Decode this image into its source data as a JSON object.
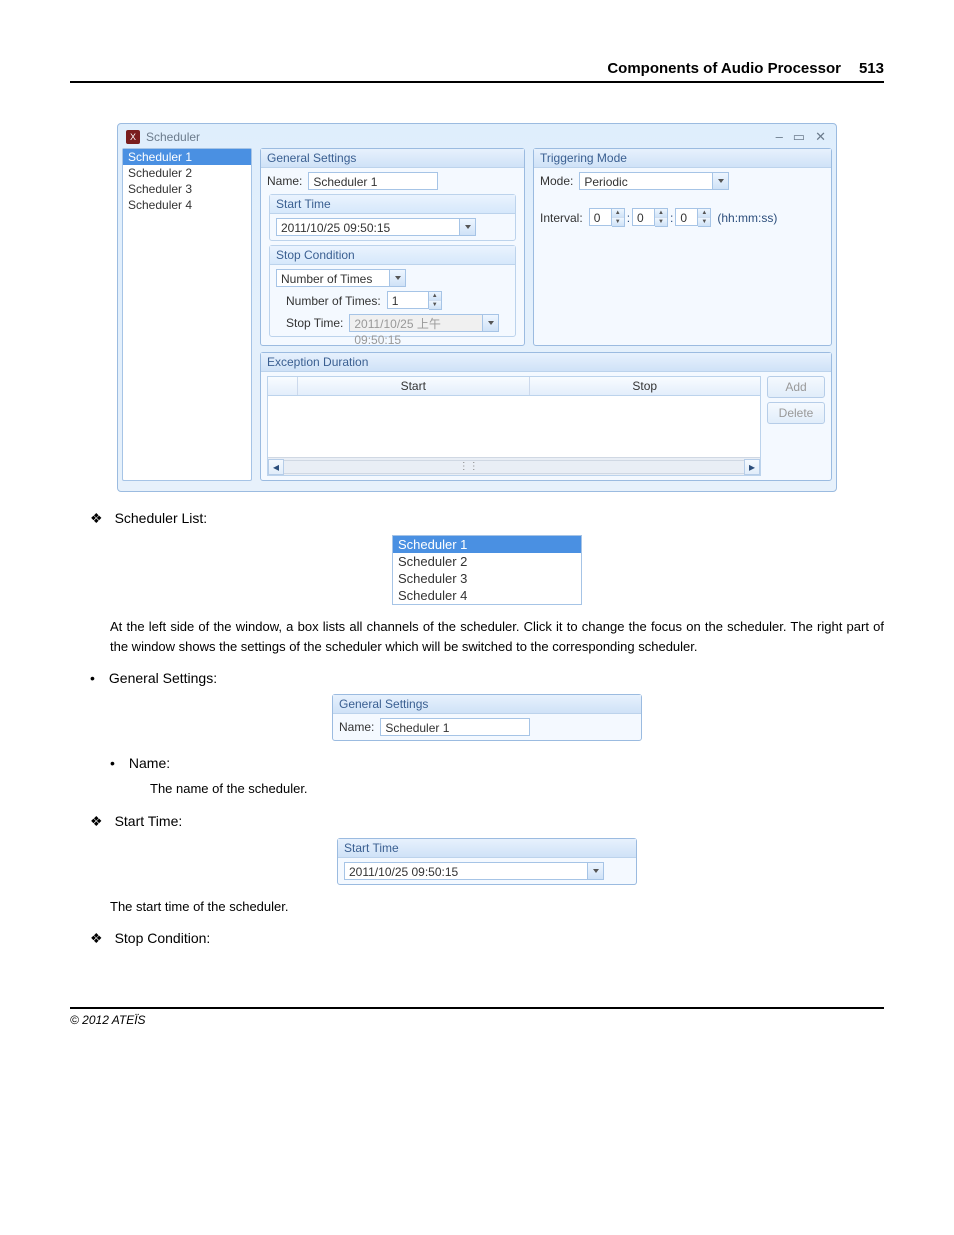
{
  "header": {
    "title": "Components of Audio Processor",
    "page": "513"
  },
  "window": {
    "title": "Scheduler",
    "controls": {
      "min": "–",
      "max": "▭",
      "close": "✕"
    },
    "sidebar": [
      "Scheduler 1",
      "Scheduler 2",
      "Scheduler 3",
      "Scheduler 4"
    ],
    "general": {
      "title": "General Settings",
      "name_label": "Name:",
      "name_value": "Scheduler 1",
      "start_title": "Start Time",
      "start_value": "2011/10/25        09:50:15",
      "stop_title": "Stop Condition",
      "stop_type": "Number of Times",
      "num_label": "Number of Times:",
      "num_value": "1",
      "stoptime_label": "Stop Time:",
      "stoptime_value": "2011/10/25 上午 09:50:15"
    },
    "trigger": {
      "title": "Triggering Mode",
      "mode_label": "Mode:",
      "mode_value": "Periodic",
      "interval_label": "Interval:",
      "h": "0",
      "m": "0",
      "s": "0",
      "units": "(hh:mm:ss)"
    },
    "exception": {
      "title": "Exception Duration",
      "col_start": "Start",
      "col_stop": "Stop",
      "add": "Add",
      "delete": "Delete"
    }
  },
  "doc": {
    "scheduler_list_heading": "Scheduler List:",
    "list_items": [
      "Scheduler 1",
      "Scheduler 2",
      "Scheduler 3",
      "Scheduler 4"
    ],
    "para1": "At the left side of the window, a box lists all channels of the scheduler. Click it to change the focus on the scheduler. The right part of the window shows the settings of the scheduler which will be switched to the corresponding scheduler.",
    "gen_heading": "General Settings:",
    "gen_box_title": "General Settings",
    "gen_box_name_label": "Name:",
    "gen_box_name_value": "Scheduler 1",
    "name_heading": "Name:",
    "name_para": "The name of the scheduler.",
    "start_heading": "Start Time:",
    "start_box_title": "Start Time",
    "start_box_value": "2011/10/25        09:50:15",
    "start_para": "The start time of the scheduler.",
    "stop_heading": "Stop Condition:"
  },
  "footer": "© 2012 ATEÏS"
}
